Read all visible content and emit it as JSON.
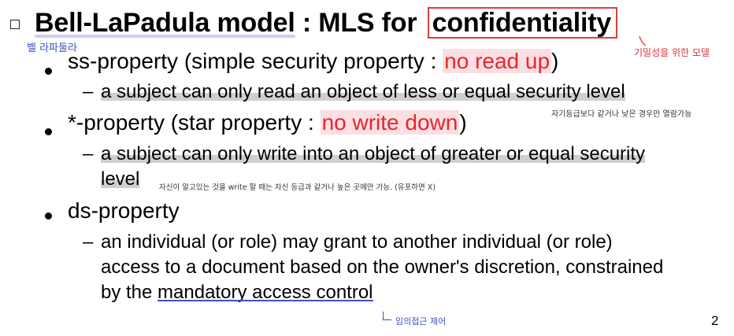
{
  "title": {
    "part1": "Bell-LaPadula model",
    "part2": " : MLS for ",
    "part3": "confidentiality"
  },
  "notes": {
    "blp_korean": "벨 라파둘라",
    "conf_korean": "기밀성을 위한 모델",
    "nru_korean": "자기등급보다 같거나 낮은 경우만 열람가능",
    "nwd_korean": "자신이 알고있는 것을 write 할 때는 자신 등급과 같거나 높은 곳에만 가능. (유포하면 X)",
    "mac_korean": "임의접근 제어"
  },
  "bullets": {
    "ss": {
      "prefix": "ss-property (simple security property : ",
      "highlight": "no read up",
      "suffix": ")",
      "sub": "a subject can only read an object of less or equal security level"
    },
    "star": {
      "prefix": "*-property (star property : ",
      "highlight": "no write down",
      "suffix": ")",
      "sub_line1": "a subject can only write into an object of greater or equal security",
      "sub_line2": "level"
    },
    "ds": {
      "label": "ds-property",
      "sub_line1": "an individual (or role) may grant to another individual (or role)",
      "sub_line2": "access to a document based on the owner's discretion, constrained",
      "sub_line3_prefix": "by the ",
      "sub_line3_link": "mandatory access control"
    }
  },
  "dash": "–",
  "page_number": "2"
}
